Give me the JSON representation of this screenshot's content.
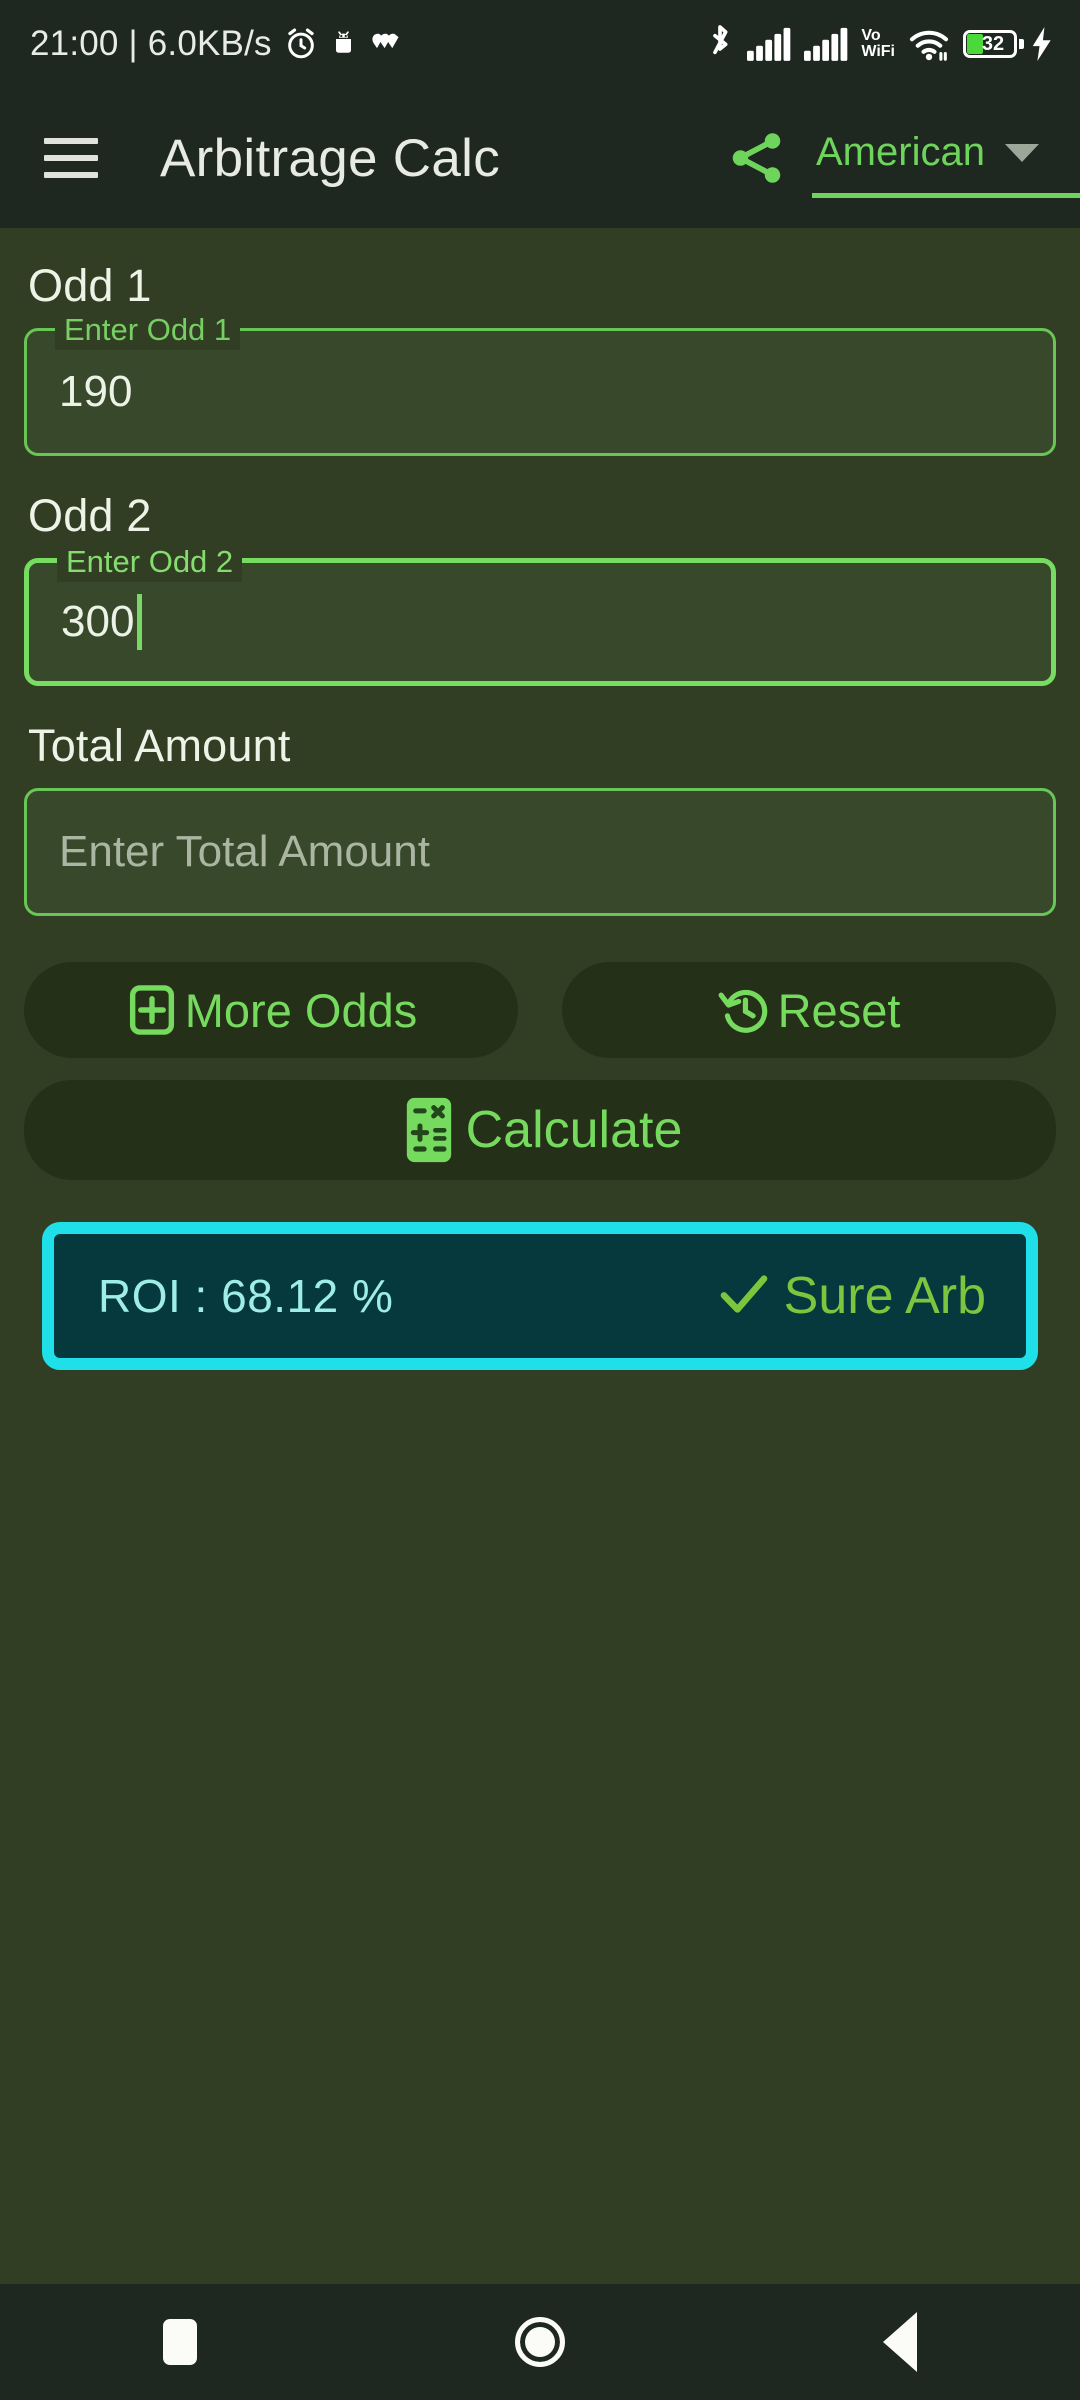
{
  "status_bar": {
    "clock": "21:00 | 6.0KB/s",
    "icons_left": [
      "alarm-icon",
      "android-debug-icon",
      "activity-icon"
    ],
    "icons_right": [
      "bluetooth-icon",
      "signal-sim1-icon",
      "signal-sim2-icon",
      "vowifi-icon",
      "wifi-icon",
      "battery-icon",
      "charging-bolt-icon"
    ],
    "vowifi_top": "Vo",
    "vowifi_bottom": "WiFi",
    "battery_percent": "32"
  },
  "app_bar": {
    "menu_icon": "hamburger-menu-icon",
    "title": "Arbitrage Calc",
    "share_icon": "share-icon",
    "odds_format": "American",
    "caret_icon": "chevron-down-icon"
  },
  "form": {
    "odd1": {
      "section_label": "Odd 1",
      "floating_label": "Enter Odd 1",
      "value": "190",
      "focused": false
    },
    "odd2": {
      "section_label": "Odd 2",
      "floating_label": "Enter Odd 2",
      "value": "300",
      "focused": true
    },
    "total": {
      "section_label": "Total Amount",
      "placeholder": "Enter Total Amount",
      "value": ""
    }
  },
  "buttons": {
    "more_odds": {
      "label": "More Odds",
      "icon": "add-box-icon"
    },
    "reset": {
      "label": "Reset",
      "icon": "history-restore-icon"
    },
    "calculate": {
      "label": "Calculate",
      "icon": "calculator-icon"
    }
  },
  "result": {
    "roi_text": "ROI :  68.12 %",
    "status_icon": "check-mark-icon",
    "status_text": "Sure Arb"
  },
  "nav_bar": {
    "recents": "recents-square-icon",
    "home": "home-circle-icon",
    "back": "back-triangle-icon"
  },
  "colors": {
    "accent_green": "#67c655",
    "bright_green": "#76da5e",
    "body_bg": "#313e24",
    "bar_bg": "#1e2720",
    "field_bg": "#37482b",
    "card_bg": "#06393e",
    "card_border": "#1fe0e8",
    "roi_text": "#9eeee6",
    "sure_text": "#7cc63e",
    "battery_fill": "#4ad83a"
  }
}
